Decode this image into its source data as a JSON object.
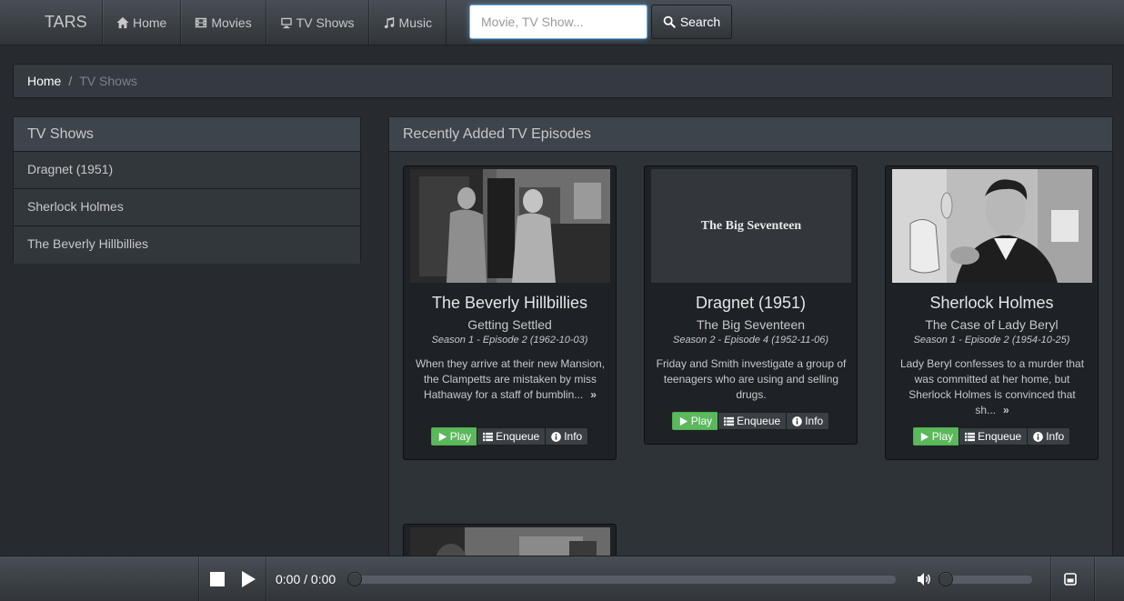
{
  "brand": "TARS",
  "nav": {
    "items": [
      {
        "label": "Home",
        "icon": "home-icon"
      },
      {
        "label": "Movies",
        "icon": "film-icon"
      },
      {
        "label": "TV Shows",
        "icon": "tv-icon"
      },
      {
        "label": "Music",
        "icon": "music-icon"
      }
    ]
  },
  "search": {
    "placeholder": "Movie, TV Show...",
    "value": "",
    "button_label": "Search"
  },
  "breadcrumb": {
    "home": "Home",
    "separator": "/",
    "active": "TV Shows"
  },
  "sidebar": {
    "title": "TV Shows",
    "items": [
      {
        "label": "Dragnet (1951)"
      },
      {
        "label": "Sherlock Holmes"
      },
      {
        "label": "The Beverly Hillbillies"
      }
    ]
  },
  "main": {
    "title": "Recently Added TV Episodes",
    "episodes": [
      {
        "show": "The Beverly Hillbillies",
        "episode": "Getting Settled",
        "meta": "Season 1 - Episode 2 (1962-10-03)",
        "description": "When they arrive at their new Mansion, the Clampetts are mistaken by miss Hathaway for a staff of bumblin...",
        "more": "»"
      },
      {
        "show": "Dragnet (1951)",
        "episode": "The Big Seventeen",
        "thumb_text": "The Big Seventeen",
        "meta": "Season 2 - Episode 4 (1952-11-06)",
        "description": "Friday and Smith investigate a group of teenagers who are using and selling drugs.",
        "more": ""
      },
      {
        "show": "Sherlock Holmes",
        "episode": "The Case of Lady Beryl",
        "meta": "Season 1 - Episode 2 (1954-10-25)",
        "description": "Lady Beryl confesses to a murder that was committed at her home, but Sherlock Holmes is convinced that sh...",
        "more": "»"
      }
    ],
    "buttons": {
      "play": "Play",
      "enqueue": "Enqueue",
      "info": "Info"
    }
  },
  "player": {
    "time": "0:00 / 0:00",
    "progress": 0,
    "volume": 0
  },
  "colors": {
    "background": "#272b30",
    "accent_play": "#5cb85c",
    "focus_outline": "#66afe9"
  }
}
